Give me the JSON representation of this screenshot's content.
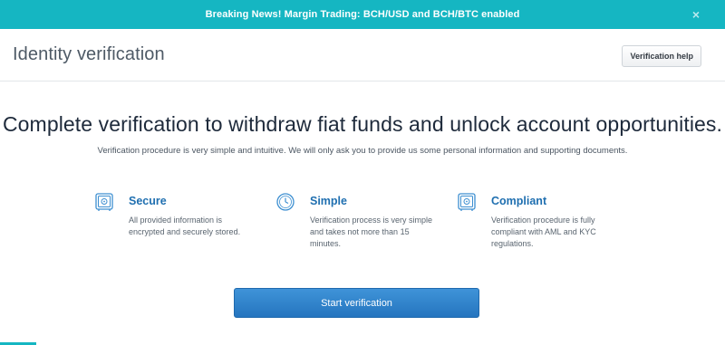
{
  "banner": {
    "text": "Breaking News! Margin Trading: BCH/USD and BCH/BTC enabled",
    "close_glyph": "×",
    "background_color": "#15b6c2"
  },
  "header": {
    "title": "Identity verification",
    "help_button_label": "Verification help"
  },
  "main": {
    "headline": "Complete verification to withdraw fiat funds and unlock account opportunities.",
    "subline": "Verification procedure is very simple and intuitive. We will only ask you to provide us some personal information and supporting documents.",
    "features": [
      {
        "icon": "safe-icon",
        "title": "Secure",
        "description": "All provided information is encrypted and securely stored."
      },
      {
        "icon": "clock-icon",
        "title": "Simple",
        "description": "Verification process is very simple and takes not more than 15 minutes."
      },
      {
        "icon": "safe-icon",
        "title": "Compliant",
        "description": "Verification procedure is fully compliant with AML and KYC regulations."
      }
    ],
    "start_button_label": "Start verification",
    "accent_color": "#1f6fb0"
  }
}
